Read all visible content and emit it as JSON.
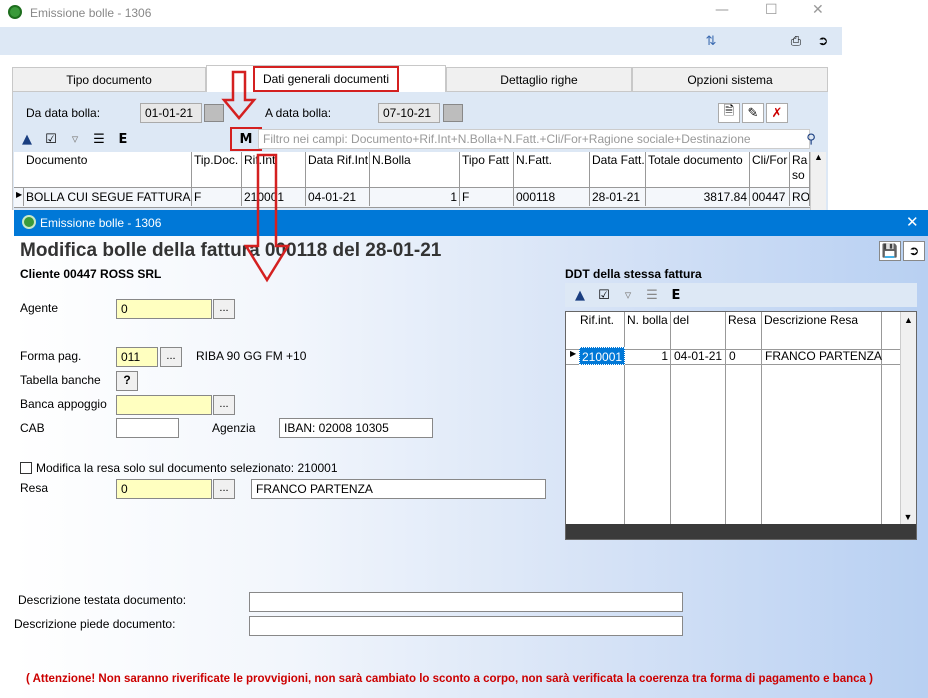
{
  "main_window": {
    "title": "Emissione bolle - 1306",
    "tabs": [
      "Tipo documento",
      "Dati generali documenti",
      "Dettaglio righe",
      "Opzioni sistema"
    ],
    "from_label": "Da data bolla:",
    "from_value": "01-01-21",
    "to_label": "A data bolla:",
    "to_value": "07-10-21",
    "filter_placeholder": "Filtro nei campi: Documento+Rif.Int+N.Bolla+N.Fatt.+Cli/For+Ragione sociale+Destinazione",
    "grid": {
      "headers": [
        "Documento",
        "Tip.Doc.",
        "Rif.Int",
        "Data Rif.Int",
        "N.Bolla",
        "Tipo Fatt",
        "N.Fatt.",
        "Data Fatt.",
        "Totale documento",
        "Cli/For",
        "Ra so"
      ],
      "row": [
        "BOLLA CUI SEGUE FATTURA",
        "F",
        "210001",
        "04-01-21",
        "1",
        "F",
        "000118",
        "28-01-21",
        "3817.84",
        "00447",
        "RO"
      ]
    }
  },
  "dialog": {
    "title": "Emissione bolle - 1306",
    "heading": "Modifica bolle della fattura 000118 del 28-01-21",
    "cliente": "Cliente 00447 ROSS SRL",
    "ddt_label": "DDT della stessa fattura",
    "agente_label": "Agente",
    "agente_value": "0",
    "forma_label": "Forma pag.",
    "forma_value": "011",
    "forma_desc": "RIBA 90 GG FM +10",
    "tabella_label": "Tabella banche",
    "tabella_btn": "?",
    "banca_label": "Banca appoggio",
    "cab_label": "CAB",
    "agenzia_label": "Agenzia",
    "iban_value": "IBAN:  02008 10305",
    "modifica_label": "Modifica la resa solo sul documento selezionato: 210001",
    "resa_label": "Resa",
    "resa_value": "0",
    "resa_desc": "FRANCO PARTENZA",
    "desc_testata_label": "Descrizione testata documento:",
    "desc_piede_label": "Descrizione piede documento:",
    "warning": "( Attenzione! Non saranno riverificate le provvigioni, non sarà cambiato lo sconto a corpo, non sarà verificata la coerenza tra forma di pagamento e banca )",
    "ddt_grid": {
      "headers": [
        "Rif.int.",
        "N. bolla",
        "del",
        "Resa",
        "Descrizione Resa"
      ],
      "row": [
        "210001",
        "1",
        "04-01-21",
        "0",
        "FRANCO PARTENZA"
      ]
    },
    "dots": "..."
  },
  "colors": {
    "title_bar": "#0078d7",
    "highlight_red": "#d42020",
    "selected_cell": "#0078d7",
    "warning": "#cc0000"
  }
}
